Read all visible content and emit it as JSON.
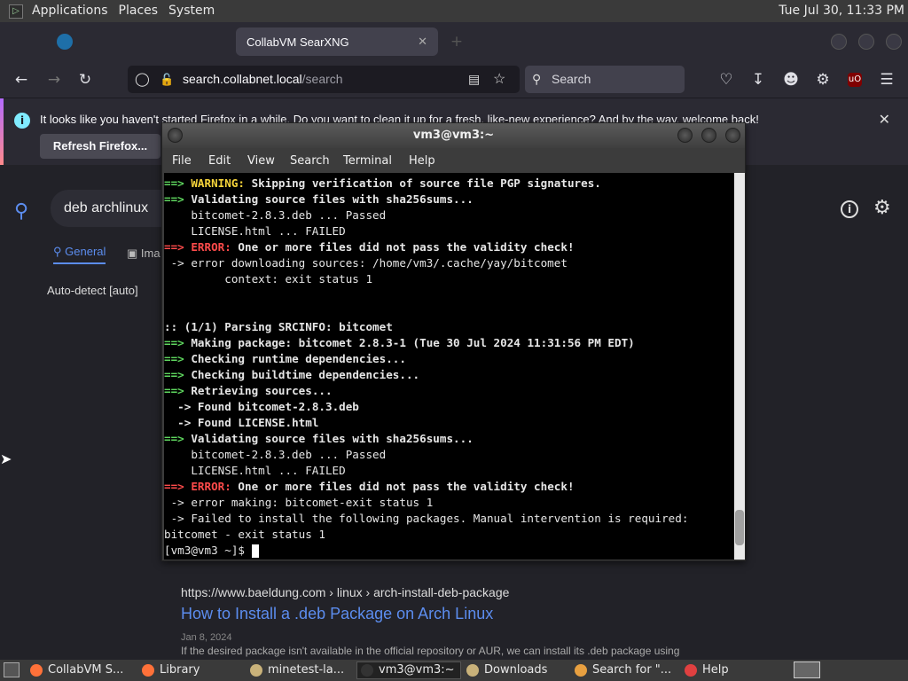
{
  "top_panel": {
    "menus": [
      "Applications",
      "Places",
      "System"
    ],
    "clock": "Tue Jul 30, 11:33 PM"
  },
  "browser": {
    "tabs": [
      {
        "label": "",
        "active": false
      },
      {
        "label": "CollabVM SearXNG",
        "active": true
      }
    ],
    "url_host": "search.collabnet.local",
    "url_path": "/search",
    "search_placeholder": "Search",
    "notification": {
      "message": "It looks like you haven't started Firefox in a while. Do you want to clean it up for a fresh, like-new experience? And by the way, welcome back!",
      "button_label": "Refresh Firefox..."
    }
  },
  "searx": {
    "query": "deb archlinux",
    "tab_general": "General",
    "tab_images": "Ima",
    "language": "Auto-detect [auto]",
    "result": {
      "url": "https://www.baeldung.com  › linux › arch-install-deb-package",
      "title": "How to Install a .deb Package on Arch Linux",
      "date": "Jan 8, 2024",
      "snippet": "If the desired package isn't available in the official repository or AUR, we can install its .deb package using"
    }
  },
  "terminal": {
    "title": "vm3@vm3:~",
    "menu": [
      "File",
      "Edit",
      "View",
      "Search",
      "Terminal",
      "Help"
    ],
    "lines": [
      [
        {
          "t": "==> ",
          "c": "g"
        },
        {
          "t": "WARNING:",
          "c": "y"
        },
        {
          "t": " Skipping verification of source file PGP signatures.",
          "c": "b"
        }
      ],
      [
        {
          "t": "==> ",
          "c": "g"
        },
        {
          "t": "Validating source files with sha256sums...",
          "c": "b"
        }
      ],
      [
        {
          "t": "    bitcomet-2.8.3.deb ... Passed",
          "c": ""
        }
      ],
      [
        {
          "t": "    LICENSE.html ... FAILED",
          "c": ""
        }
      ],
      [
        {
          "t": "==> ",
          "c": "r"
        },
        {
          "t": "ERROR:",
          "c": "r"
        },
        {
          "t": " One or more files did not pass the validity check!",
          "c": "b"
        }
      ],
      [
        {
          "t": " -> error downloading sources: /home/vm3/.cache/yay/bitcomet",
          "c": ""
        }
      ],
      [
        {
          "t": "         context: exit status 1",
          "c": ""
        }
      ],
      [
        {
          "t": "",
          "c": ""
        }
      ],
      [
        {
          "t": "",
          "c": ""
        }
      ],
      [
        {
          "t": ":: (1/1) Parsing SRCINFO: bitcomet",
          "c": "b"
        }
      ],
      [
        {
          "t": "==> ",
          "c": "g"
        },
        {
          "t": "Making package: bitcomet 2.8.3-1 (Tue 30 Jul 2024 11:31:56 PM EDT)",
          "c": "b"
        }
      ],
      [
        {
          "t": "==> ",
          "c": "g"
        },
        {
          "t": "Checking runtime dependencies...",
          "c": "b"
        }
      ],
      [
        {
          "t": "==> ",
          "c": "g"
        },
        {
          "t": "Checking buildtime dependencies...",
          "c": "b"
        }
      ],
      [
        {
          "t": "==> ",
          "c": "g"
        },
        {
          "t": "Retrieving sources...",
          "c": "b"
        }
      ],
      [
        {
          "t": "  -> ",
          "c": "b"
        },
        {
          "t": "Found bitcomet-2.8.3.deb",
          "c": "b"
        }
      ],
      [
        {
          "t": "  -> ",
          "c": "b"
        },
        {
          "t": "Found LICENSE.html",
          "c": "b"
        }
      ],
      [
        {
          "t": "==> ",
          "c": "g"
        },
        {
          "t": "Validating source files with sha256sums...",
          "c": "b"
        }
      ],
      [
        {
          "t": "    bitcomet-2.8.3.deb ... Passed",
          "c": ""
        }
      ],
      [
        {
          "t": "    LICENSE.html ... FAILED",
          "c": ""
        }
      ],
      [
        {
          "t": "==> ",
          "c": "r"
        },
        {
          "t": "ERROR:",
          "c": "r"
        },
        {
          "t": " One or more files did not pass the validity check!",
          "c": "b"
        }
      ],
      [
        {
          "t": " -> error making: bitcomet-exit status 1",
          "c": ""
        }
      ],
      [
        {
          "t": " -> Failed to install the following packages. Manual intervention is required:",
          "c": ""
        }
      ],
      [
        {
          "t": "bitcomet - exit status 1",
          "c": ""
        }
      ]
    ],
    "prompt": "[vm3@vm3 ~]$ "
  },
  "taskbar": {
    "items": [
      {
        "label": "CollabVM S...",
        "icon": "firefox-icon",
        "color": "#ff7139",
        "active": false
      },
      {
        "label": "Library",
        "icon": "firefox-icon",
        "color": "#ff7139",
        "active": false
      },
      {
        "label": "minetest-la...",
        "icon": "folder-icon",
        "color": "#c9b27a",
        "active": false
      },
      {
        "label": "vm3@vm3:~",
        "icon": "terminal-icon",
        "color": "#333333",
        "active": true
      },
      {
        "label": "Downloads",
        "icon": "folder-icon",
        "color": "#c9b27a",
        "active": false
      },
      {
        "label": "Search for \"...",
        "icon": "search-icon",
        "color": "#e8a040",
        "active": false
      },
      {
        "label": "Help",
        "icon": "help-icon",
        "color": "#e04040",
        "active": false
      }
    ]
  }
}
